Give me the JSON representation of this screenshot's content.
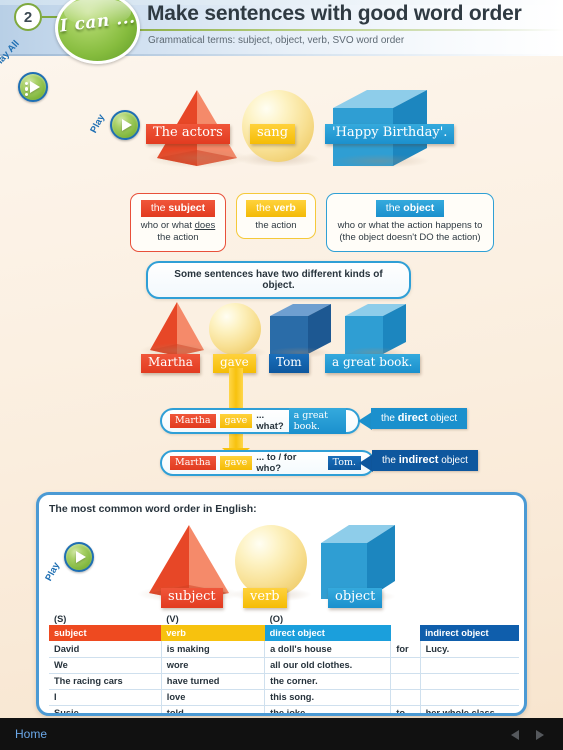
{
  "header": {
    "number": "2",
    "ican_label": "I can ...",
    "title": "Make sentences with good word order",
    "subtitle": "Grammatical terms: subject, object, verb, SVO word order"
  },
  "controls": {
    "play_all_label": "Play All",
    "play_label": "Play",
    "play_icon": "play-triangle-icon"
  },
  "example1": {
    "shapes": [
      {
        "kind": "pyramid",
        "color": "#e8503a",
        "label": "The actors",
        "tag_style": "red"
      },
      {
        "kind": "sphere",
        "color": "#f7db84",
        "label": "sang",
        "tag_style": "yellow"
      },
      {
        "kind": "cube",
        "color": "#3aa7dc",
        "label": "'Happy Birthday'.",
        "tag_style": "blue"
      }
    ]
  },
  "definitions": [
    {
      "head_prefix": "the ",
      "head_word": "subject",
      "color": "#e8503a",
      "line1_a": "who or what ",
      "line1_u": "does",
      "line2": "the action"
    },
    {
      "head_prefix": "the ",
      "head_word": "verb",
      "color": "#f5c215",
      "line1_a": "the action",
      "line1_u": "",
      "line2": ""
    },
    {
      "head_prefix": "the ",
      "head_word": "object",
      "color": "#1b90cd",
      "line1_a": "who or what the action happens to",
      "line1_u": "",
      "line2": "(the object doesn't DO the action)"
    }
  ],
  "banner": {
    "text": "Some sentences have two different kinds of object."
  },
  "example2": {
    "shapes": [
      {
        "kind": "pyramid",
        "color": "#e8503a",
        "label": "Martha",
        "tag_style": "red"
      },
      {
        "kind": "sphere",
        "color": "#f7db84",
        "label": "gave",
        "tag_style": "yellow"
      },
      {
        "kind": "cube",
        "color": "#2a6ca8",
        "label": "Tom",
        "tag_style": "dblue"
      },
      {
        "kind": "cube",
        "color": "#3aa7dc",
        "label": "a great book.",
        "tag_style": "blue"
      }
    ]
  },
  "object_rows": [
    {
      "subject": "Martha",
      "verb": "gave",
      "question": "... what?",
      "answer": "a great book.",
      "answer_style": "blue",
      "callout_prefix": "the ",
      "callout_bold": "direct",
      "callout_suffix": " object",
      "callout_color": "#1b90cd"
    },
    {
      "subject": "Martha",
      "verb": "gave",
      "question": "... to / for who?",
      "answer": "Tom.",
      "answer_style": "dblue",
      "callout_prefix": "the ",
      "callout_bold": "indirect",
      "callout_suffix": " object",
      "callout_color": "#0e579e"
    }
  ],
  "panel": {
    "title": "The most common word order in English:",
    "shapes": [
      {
        "kind": "pyramid",
        "color": "#e8503a",
        "label": "subject",
        "tag_style": "red"
      },
      {
        "kind": "sphere",
        "color": "#f7db84",
        "label": "verb",
        "tag_style": "yellow"
      },
      {
        "kind": "cube",
        "color": "#3aa7dc",
        "label": "object",
        "tag_style": "blue"
      }
    ],
    "table": {
      "notes": [
        "(S)",
        "(V)",
        "(O)",
        "",
        ""
      ],
      "tags": [
        {
          "label": "subject",
          "color": "#ee4a20"
        },
        {
          "label": "verb",
          "color": "#f7c20e"
        },
        {
          "label": "direct object",
          "color": "#1b9fdc"
        },
        {
          "label": "",
          "color": "transparent"
        },
        {
          "label": "indirect object",
          "color": "#0f5eac"
        }
      ],
      "rows": [
        [
          "David",
          "is making",
          "a doll's house",
          "for",
          "Lucy."
        ],
        [
          "We",
          "wore",
          "all our old clothes.",
          "",
          ""
        ],
        [
          "The racing cars",
          "have turned",
          "the corner.",
          "",
          ""
        ],
        [
          "I",
          "love",
          "this song.",
          "",
          ""
        ],
        [
          "Susie",
          "told",
          "the joke",
          "to",
          "her whole class."
        ]
      ]
    }
  },
  "navbar": {
    "home_label": "Home",
    "prev_icon": "triangle-left-icon",
    "next_icon": "triangle-right-icon"
  }
}
